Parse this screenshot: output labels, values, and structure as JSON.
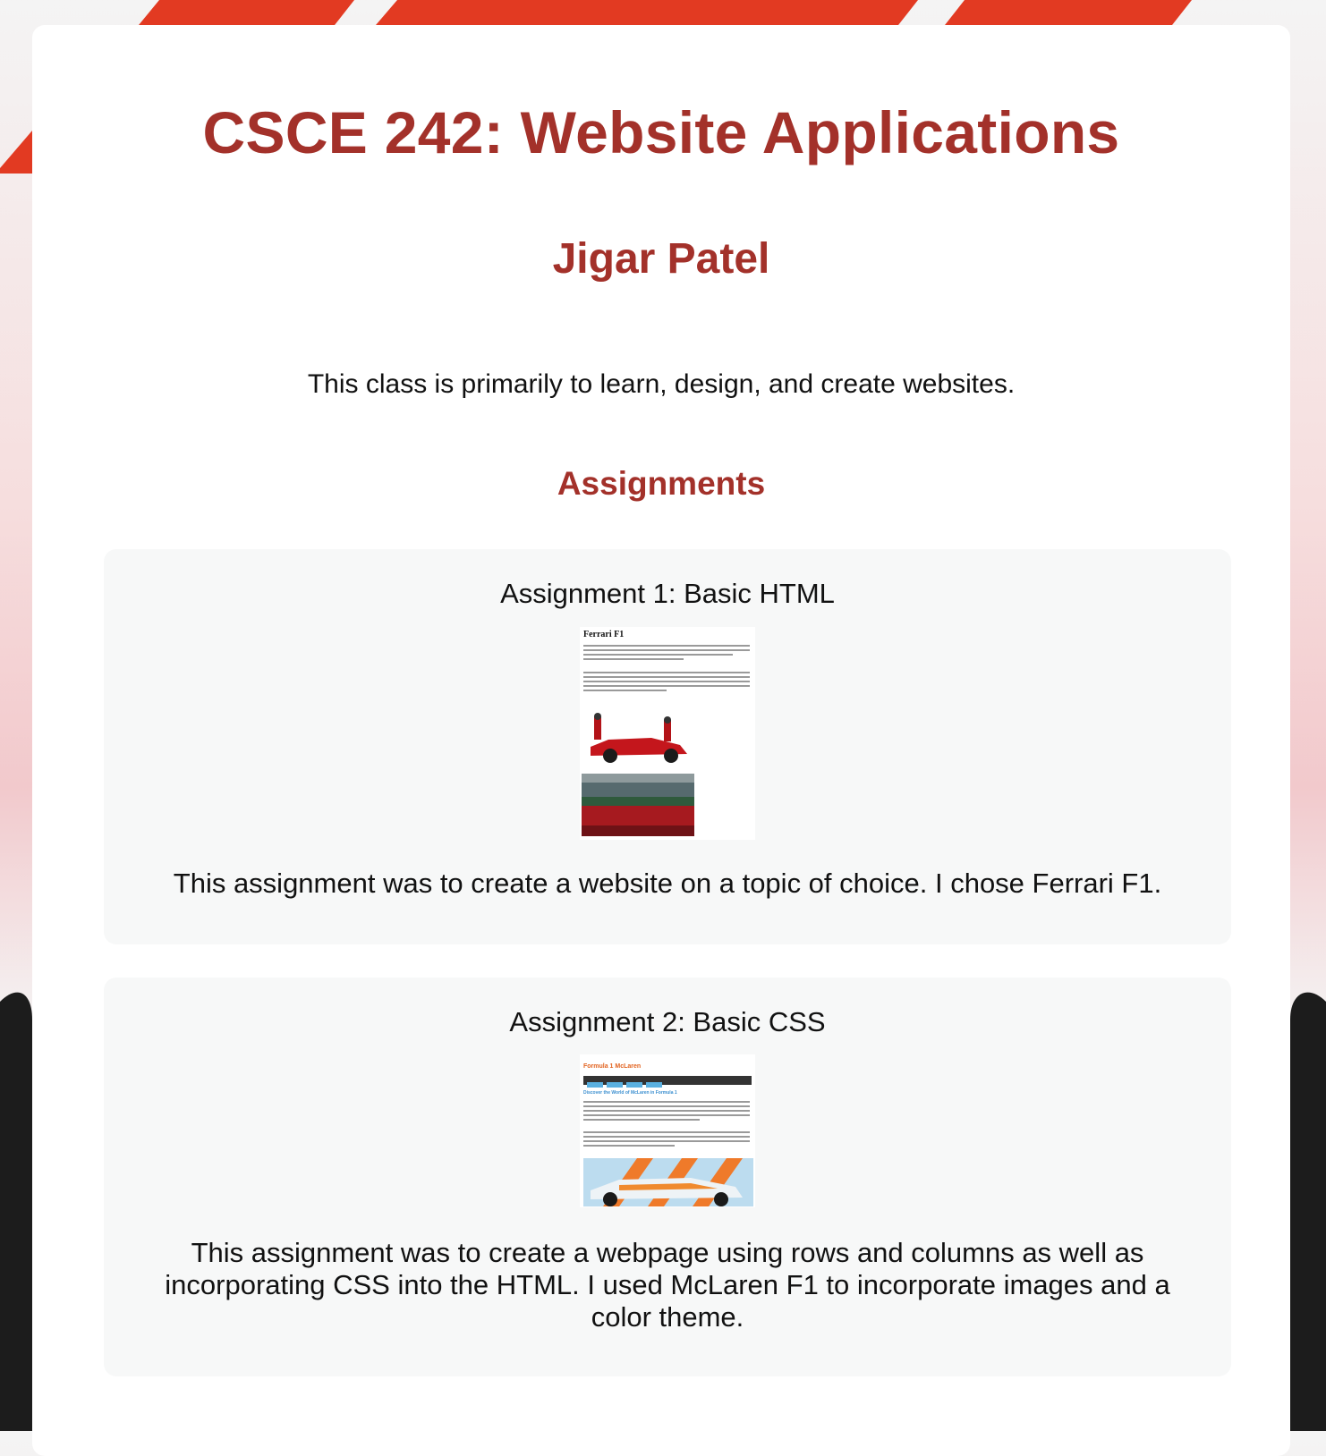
{
  "page": {
    "title": "CSCE 242: Website Applications",
    "author": "Jigar Patel",
    "intro": "This class is primarily to learn, design, and create websites.",
    "section_heading": "Assignments"
  },
  "assignments": [
    {
      "title": "Assignment 1: Basic HTML",
      "thumbnail_heading": "Ferrari F1",
      "description": "This assignment was to create a website on a topic of choice. I chose Ferrari F1."
    },
    {
      "title": "Assignment 2: Basic CSS",
      "thumbnail_heading": "Formula 1 McLaren",
      "thumbnail_subheading": "Discover the World of McLaren in Formula 1",
      "description": "This assignment was to create a webpage using rows and columns as well as incorporating CSS into the HTML. I used McLaren F1 to incorporate images and a color theme."
    }
  ],
  "colors": {
    "accent": "#a3312a",
    "stripe": "#e23a22",
    "panel": "#f7f8f8"
  }
}
